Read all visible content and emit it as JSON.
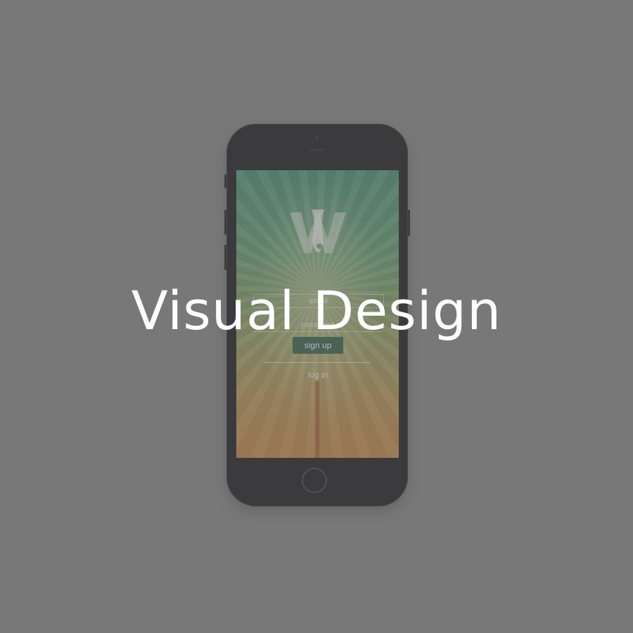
{
  "headline": "Visual Design",
  "app": {
    "logo_icon": "w-tie-logo-icon",
    "email_placeholder": "email",
    "password_placeholder": "password",
    "signup_label": "sign up",
    "login_label": "log in"
  },
  "colors": {
    "page_background": "#808080",
    "phone_body": "#111214",
    "signup_button": "#2d5a42",
    "headline_text": "#ffffff"
  }
}
